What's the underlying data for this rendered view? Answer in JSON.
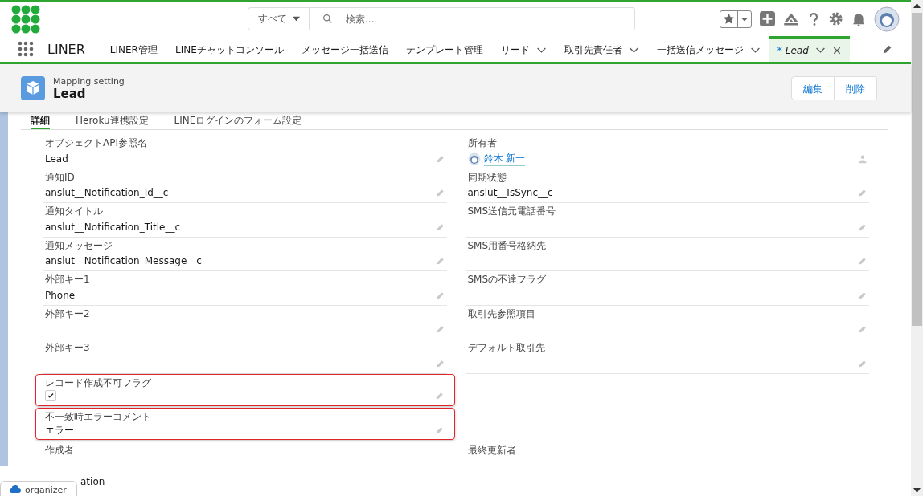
{
  "header": {
    "search_scope": "すべて",
    "search": {
      "placeholder": "検索..."
    }
  },
  "nav": {
    "app_name": "LINER",
    "items": [
      {
        "label": "LINER管理",
        "menu": false,
        "selected": false
      },
      {
        "label": "LINEチャットコンソール",
        "menu": false,
        "selected": false
      },
      {
        "label": "メッセージ一括送信",
        "menu": false,
        "selected": false
      },
      {
        "label": "テンプレート管理",
        "menu": false,
        "selected": false
      },
      {
        "label": "リード",
        "menu": true,
        "selected": false
      },
      {
        "label": "取引先責任者",
        "menu": true,
        "selected": false
      },
      {
        "label": "一括送信メッセージ",
        "menu": true,
        "selected": false
      },
      {
        "prefix": "*",
        "label": "Lead",
        "menu": true,
        "closable": true,
        "selected": true
      }
    ]
  },
  "record": {
    "type": "Mapping setting",
    "title": "Lead",
    "buttons": [
      "編集",
      "削除"
    ]
  },
  "tabs": [
    {
      "label": "詳細",
      "selected": true
    },
    {
      "label": "Heroku連携設定",
      "selected": false
    },
    {
      "label": "LINEログインのフォーム設定",
      "selected": false
    }
  ],
  "rows": [
    [
      {
        "kind": "text",
        "label": "オブジェクトAPI参照名",
        "value": "Lead",
        "highlighted": false
      },
      {
        "kind": "owner",
        "label": "所有者",
        "value": "鈴木 新一",
        "highlighted": false
      }
    ],
    [
      {
        "kind": "text",
        "label": "通知ID",
        "value": "anslut__Notification_Id__c",
        "highlighted": false
      },
      {
        "kind": "text",
        "label": "同期状態",
        "value": "anslut__IsSync__c",
        "highlighted": false
      }
    ],
    [
      {
        "kind": "text",
        "label": "通知タイトル",
        "value": "anslut__Notification_Title__c",
        "highlighted": false
      },
      {
        "kind": "text",
        "label": "SMS送信元電話番号",
        "highlighted": false
      }
    ],
    [
      {
        "kind": "text",
        "label": "通知メッセージ",
        "value": "anslut__Notification_Message__c",
        "highlighted": false
      },
      {
        "kind": "text",
        "label": "SMS用番号格納先",
        "highlighted": false
      }
    ],
    [
      {
        "kind": "text",
        "label": "外部キー1",
        "value": "Phone",
        "highlighted": false
      },
      {
        "kind": "text",
        "label": "SMSの不達フラグ",
        "highlighted": false
      }
    ],
    [
      {
        "kind": "text",
        "label": "外部キー2",
        "highlighted": false
      },
      {
        "kind": "text",
        "label": "取引先参照項目",
        "highlighted": false
      }
    ],
    [
      {
        "kind": "text",
        "label": "外部キー3",
        "highlighted": false
      },
      {
        "kind": "text",
        "label": "デフォルト取引先",
        "highlighted": false
      }
    ],
    [
      {
        "kind": "checkbox",
        "label": "レコード作成不可フラグ",
        "checked": true,
        "highlighted": true
      },
      null
    ],
    [
      {
        "kind": "text",
        "label": "不一致時エラーコメント",
        "value": "エラー",
        "highlighted": true
      },
      null
    ],
    [
      {
        "kind": "label",
        "label": "作成者"
      },
      {
        "kind": "label",
        "label": "最終更新者"
      }
    ]
  ],
  "footer": {
    "text": "ation",
    "badge": "organizer"
  }
}
